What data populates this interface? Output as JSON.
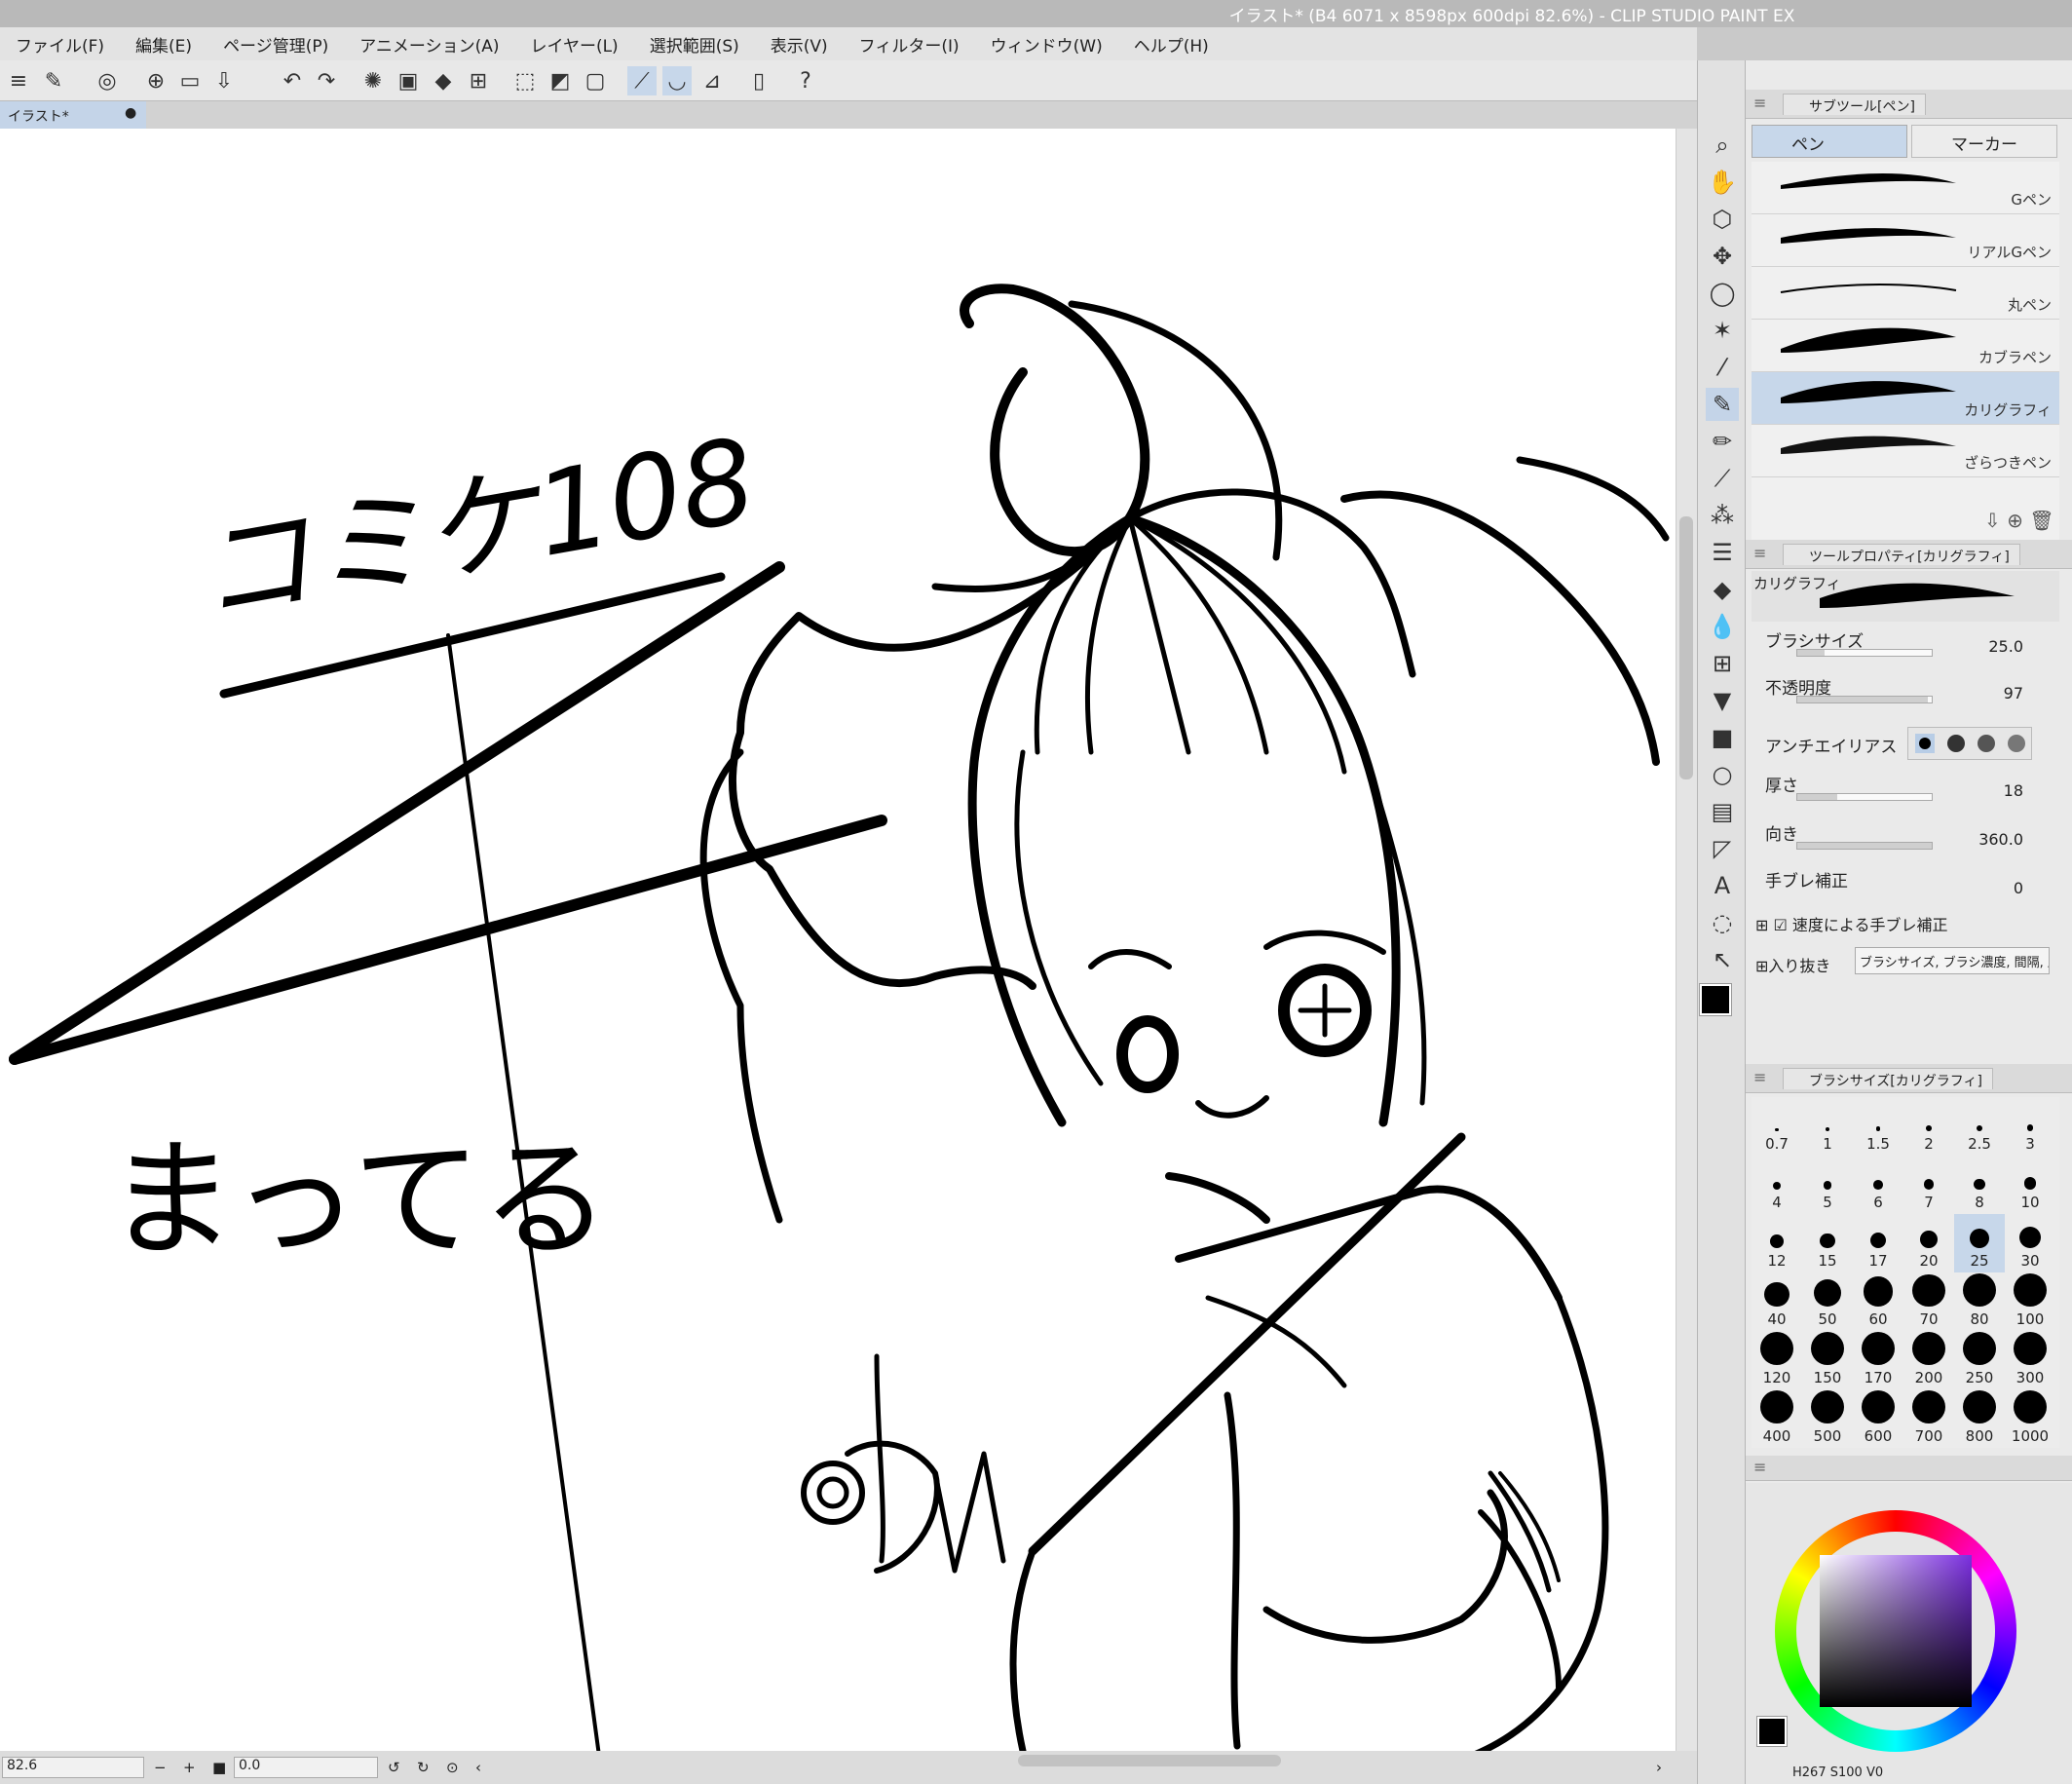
{
  "window": {
    "title": "イラスト* (B4 6071 x 8598px 600dpi 82.6%)  - CLIP STUDIO PAINT EX"
  },
  "menu": [
    "ファイル(F)",
    "編集(E)",
    "ページ管理(P)",
    "アニメーション(A)",
    "レイヤー(L)",
    "選択範囲(S)",
    "表示(V)",
    "フィルター(I)",
    "ウィンドウ(W)",
    "ヘルプ(H)"
  ],
  "document_tab": {
    "label": "イラスト*"
  },
  "canvas_text": {
    "event": "コミケ108",
    "circle": "まってる"
  },
  "status": {
    "zoom": "82.6",
    "rotation": "0.0"
  },
  "subtool_panel": {
    "title": "サブツール[ペン]",
    "groups": [
      "ペン",
      "マーカー"
    ],
    "brushes": [
      "Gペン",
      "リアルGペン",
      "丸ペン",
      "カブラペン",
      "カリグラフィ",
      "ざらつきペン"
    ],
    "selected_brush": "カリグラフィ"
  },
  "tool_property": {
    "title": "ツールプロパティ[カリグラフィ]",
    "brush_name": "カリグラフィ",
    "brush_size": {
      "label": "ブラシサイズ",
      "value": "25.0",
      "fill": 0.2
    },
    "opacity": {
      "label": "不透明度",
      "value": "97",
      "fill": 0.97
    },
    "antialias": {
      "label": "アンチエイリアス"
    },
    "thickness": {
      "label": "厚さ",
      "value": "18",
      "fill": 0.3
    },
    "direction": {
      "label": "向き",
      "value": "360.0",
      "fill": 1.0
    },
    "stabilization": {
      "label": "手ブレ補正",
      "value": "0"
    },
    "speed_stabilization": {
      "label": "速度による手ブレ補正",
      "checked": true
    },
    "taper": {
      "label": "入り抜き",
      "value": "ブラシサイズ, ブラシ濃度, 間隔, 厚"
    }
  },
  "brush_size_panel": {
    "title": "ブラシサイズ[カリグラフィ]",
    "sizes": [
      "0.7",
      "1",
      "1.5",
      "2",
      "2.5",
      "3",
      "4",
      "5",
      "6",
      "7",
      "8",
      "10",
      "12",
      "15",
      "17",
      "20",
      "25",
      "30",
      "40",
      "50",
      "60",
      "70",
      "80",
      "100",
      "120",
      "150",
      "170",
      "200",
      "250",
      "300",
      "400",
      "500",
      "600",
      "700",
      "800",
      "1000"
    ],
    "selected": "25"
  },
  "color": {
    "main": "#000000",
    "sub": "#ffffff",
    "readout": {
      "H": "267",
      "S": "100",
      "V": "0"
    },
    "square_hue": "#7b2fe0"
  }
}
